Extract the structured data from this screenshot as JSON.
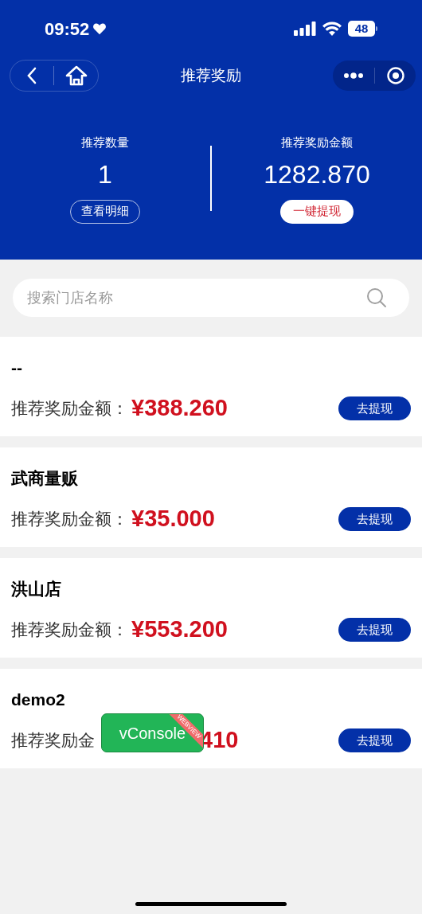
{
  "status_bar": {
    "time": "09:52",
    "battery": "48"
  },
  "nav": {
    "title": "推荐奖励"
  },
  "stats": [
    {
      "label": "推荐数量",
      "value": "1",
      "action": "查看明细",
      "kind": "outline"
    },
    {
      "label": "推荐奖励金额",
      "value": "1282.870",
      "action": "一键提现",
      "kind": "filled"
    }
  ],
  "search": {
    "placeholder": "搜索门店名称"
  },
  "stores": [
    {
      "name": "--",
      "label": "推荐奖励金额：",
      "amount": "¥388.260",
      "action": "去提现"
    },
    {
      "name": "武商量贩",
      "label": "推荐奖励金额：",
      "amount": "¥35.000",
      "action": "去提现"
    },
    {
      "name": "洪山店",
      "label": "推荐奖励金额：",
      "amount": "¥553.200",
      "action": "去提现"
    },
    {
      "name": "demo2",
      "label": "推荐奖励金",
      "amount": "410",
      "action": "去提现",
      "covered": true
    }
  ],
  "debug_button": {
    "label": "vConsole",
    "ribbon": "WEBVIEW"
  }
}
